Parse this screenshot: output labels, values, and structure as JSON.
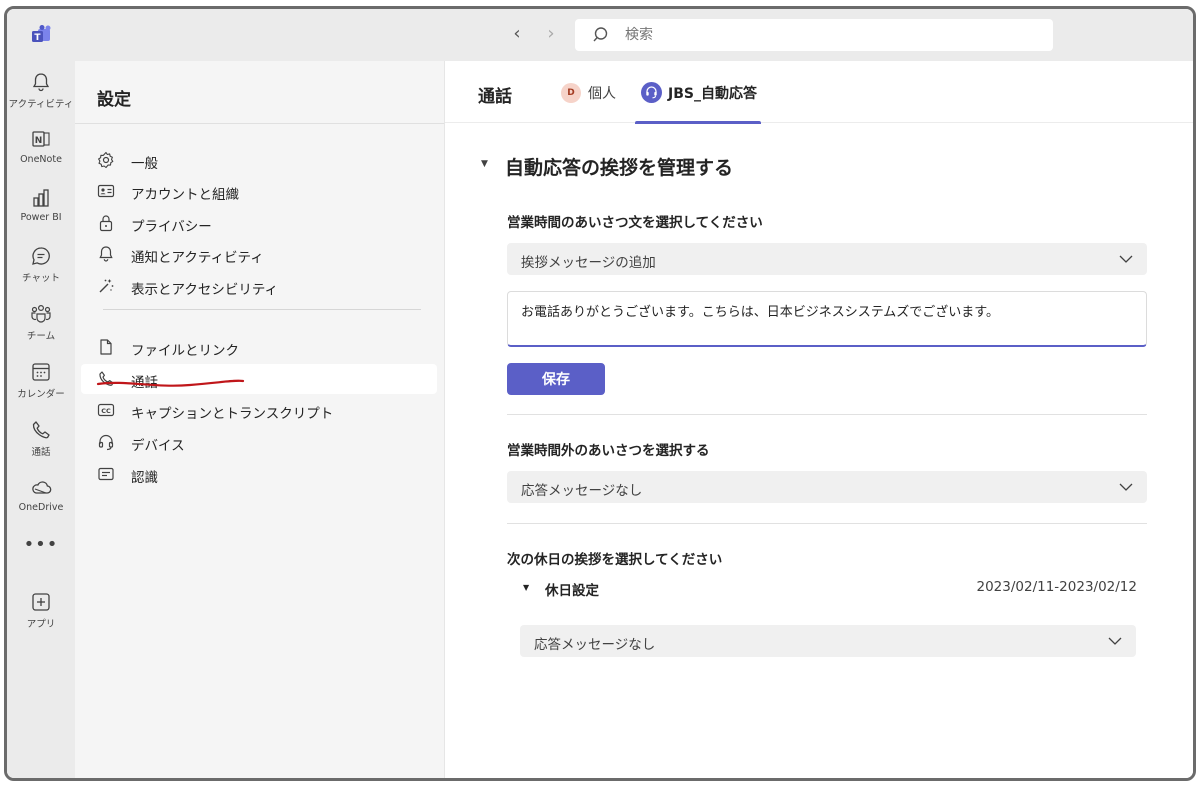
{
  "search": {
    "placeholder": "検索"
  },
  "rail": {
    "items": [
      {
        "label": "アクティビティ",
        "icon": "bell-icon"
      },
      {
        "label": "OneNote",
        "icon": "onenote-icon"
      },
      {
        "label": "Power BI",
        "icon": "powerbi-icon"
      },
      {
        "label": "チャット",
        "icon": "chat-icon"
      },
      {
        "label": "チーム",
        "icon": "teams-icon"
      },
      {
        "label": "カレンダー",
        "icon": "calendar-icon"
      },
      {
        "label": "通話",
        "icon": "phone-icon"
      },
      {
        "label": "OneDrive",
        "icon": "cloud-icon"
      }
    ],
    "more": "•••",
    "apps": {
      "label": "アプリ",
      "icon": "add-app-icon"
    }
  },
  "settings": {
    "title": "設定",
    "items_top": [
      {
        "label": "一般",
        "icon": "gear-icon"
      },
      {
        "label": "アカウントと組織",
        "icon": "id-card-icon"
      },
      {
        "label": "プライバシー",
        "icon": "lock-icon"
      },
      {
        "label": "通知とアクティビティ",
        "icon": "bell-icon"
      },
      {
        "label": "表示とアクセシビリティ",
        "icon": "magic-wand-icon"
      }
    ],
    "items_bottom": [
      {
        "label": "ファイルとリンク",
        "icon": "file-icon"
      },
      {
        "label": "通話",
        "icon": "phone-icon",
        "active": true
      },
      {
        "label": "キャプションとトランスクリプト",
        "icon": "cc-icon"
      },
      {
        "label": "デバイス",
        "icon": "headset-icon"
      },
      {
        "label": "認識",
        "icon": "text-doc-icon"
      }
    ]
  },
  "main": {
    "title": "通話",
    "tabs": [
      {
        "label": "個人",
        "avatar": "D"
      },
      {
        "label": "JBS_自動応答",
        "selected": true
      }
    ],
    "section_title": "自動応答の挨拶を管理する",
    "business_hours": {
      "label": "営業時間のあいさつ文を選択してください",
      "dropdown_value": "挨拶メッセージの追加",
      "message": "お電話ありがとうございます。こちらは、日本ビジネスシステムズでございます。",
      "save_label": "保存"
    },
    "after_hours": {
      "label": "営業時間外のあいさつを選択する",
      "dropdown_value": "応答メッセージなし"
    },
    "holiday": {
      "label": "次の休日の挨拶を選択してください",
      "setting_label": "休日設定",
      "date_range": "2023/02/11-2023/02/12",
      "dropdown_value": "応答メッセージなし"
    }
  },
  "colors": {
    "accent": "#5b5fc7",
    "annotation": "#c0161a"
  }
}
